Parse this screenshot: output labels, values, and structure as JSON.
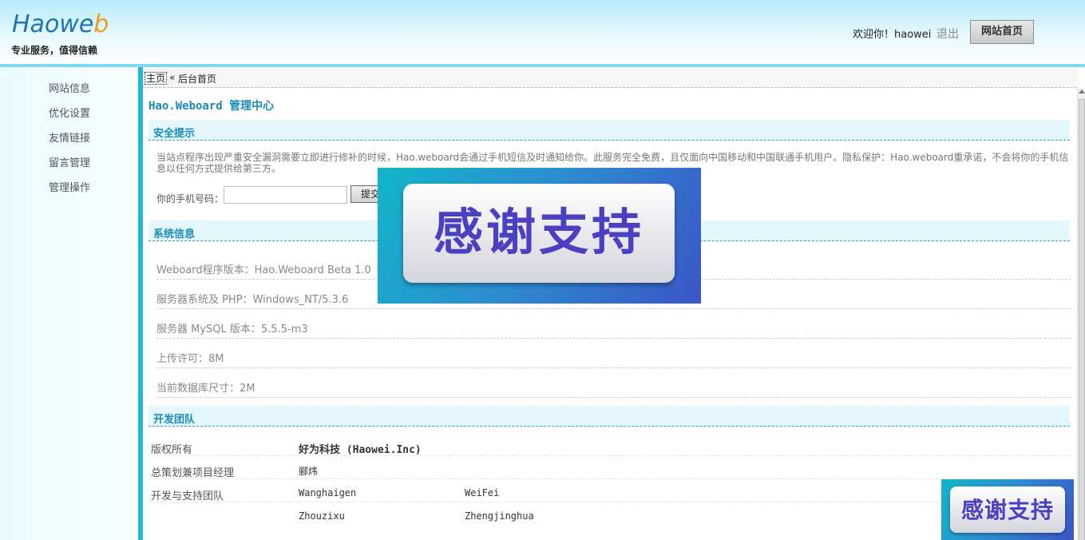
{
  "header": {
    "logo_text": "Haowe",
    "logo_accent": "b",
    "slogan": "专业服务，值得信赖",
    "welcome": "欢迎你！haowei",
    "logout": "退出",
    "home_button": "网站首页"
  },
  "sidebar": {
    "items": [
      {
        "label": "网站信息"
      },
      {
        "label": "优化设置"
      },
      {
        "label": "友情链接"
      },
      {
        "label": "留言管理"
      },
      {
        "label": "管理操作"
      }
    ]
  },
  "breadcrumb": {
    "home": "主页",
    "separator": "«",
    "current": "后台首页"
  },
  "main": {
    "title": "Hao.Weboard 管理中心",
    "security": {
      "heading": "安全提示",
      "notice": "当站点程序出现严重安全漏洞需要立即进行修补的时候，Hao.weboard会通过手机短信及时通知给你。此服务完全免费，且仅面向中国移动和中国联通手机用户。隐私保护：Hao.weboard重承诺，不会将你的手机信息以任何方式提供给第三方。",
      "phone_label": "你的手机号码：",
      "phone_value": "",
      "submit_label": "提交"
    },
    "system": {
      "heading": "系统信息",
      "rows": [
        "Weboard程序版本：Hao.Weboard Beta 1.0",
        "服务器系统及 PHP：Windows_NT/5.3.6",
        "服务器 MySQL 版本：5.5.5-m3",
        "上传许可：8M",
        "当前数据库尺寸：2M"
      ]
    },
    "team": {
      "heading": "开发团队",
      "copyright_label": "版权所有",
      "copyright_value": "好为科技 (Haowei.Inc)",
      "manager_label": "总策划兼项目经理",
      "manager_value": "郦炜",
      "dev_label": "开发与支持团队",
      "members": [
        "Wanghaigen",
        "WeiFei",
        "Zhouzixu",
        "Zhengjinghua"
      ]
    }
  },
  "overlay": {
    "banner_text": "感谢支持"
  },
  "colors": {
    "accent": "#1a8ab5",
    "sidebar_divider": "#22b8d5",
    "header_top": "#b6ebfa",
    "banner_text": "#4b3fc2"
  }
}
